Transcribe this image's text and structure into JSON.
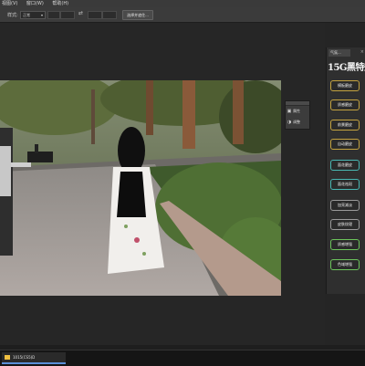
{
  "menubar": {
    "items": [
      "视图(V)",
      "窗口(W)",
      "帮助(H)"
    ]
  },
  "options": {
    "label": "样式:",
    "select_value": "正常",
    "button_label": "选择并遮住..."
  },
  "float_tool": {
    "items": [
      "属性",
      "调整"
    ]
  },
  "panel": {
    "tab_label": "气氛...",
    "logo_text": "15G黑特效",
    "buttons": [
      "模板磨皮",
      "质感磨皮",
      "前景磨皮",
      "自动磨皮",
      "面花磨皮",
      "面花祛斑",
      "加亮减淡",
      "皮肤纹理",
      "质感增强",
      "色域增强"
    ]
  },
  "taskbar": {
    "item_label": "1015(CS5)D"
  }
}
